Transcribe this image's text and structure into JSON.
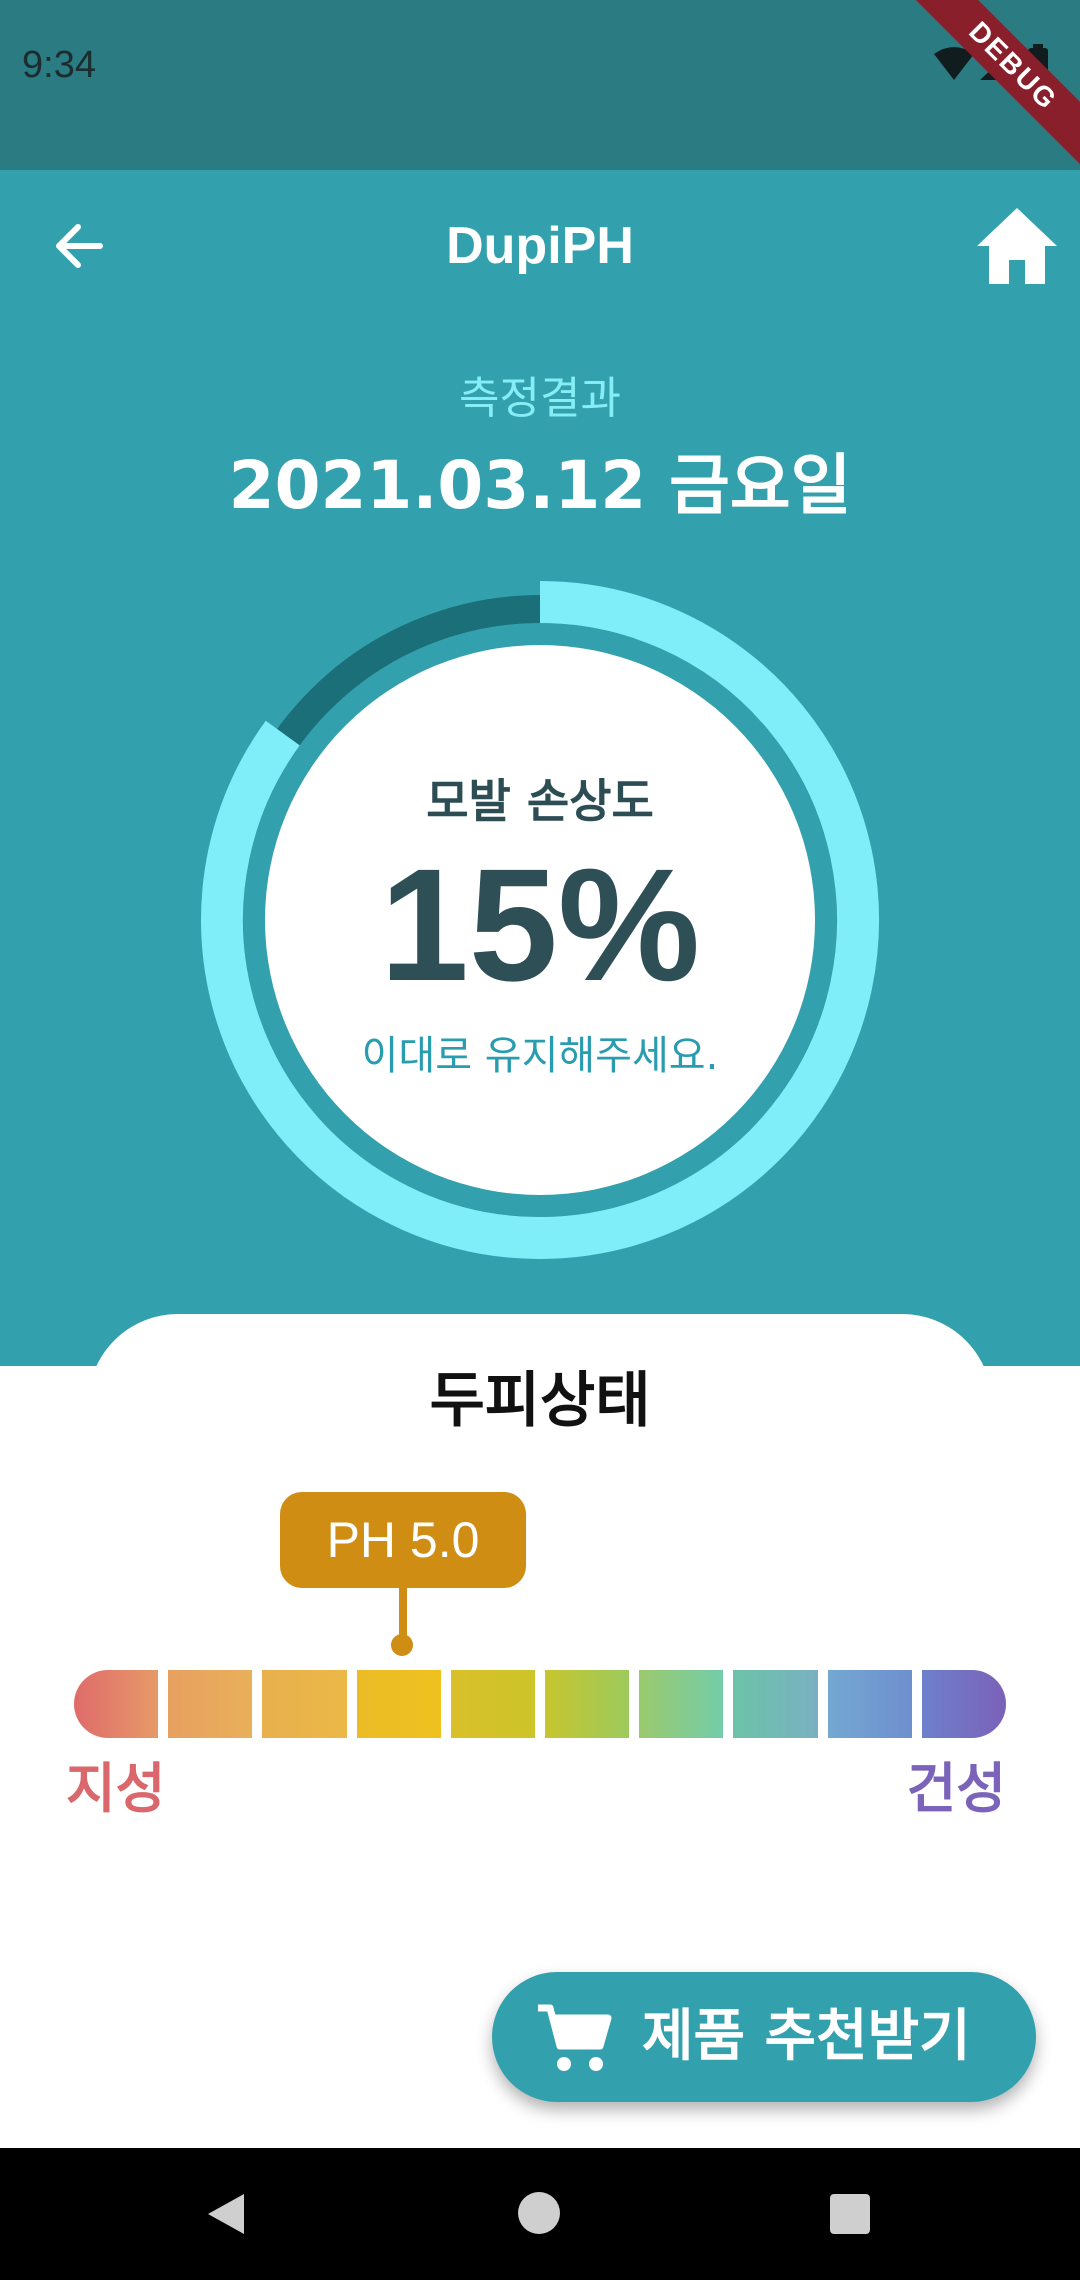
{
  "status_bar": {
    "time": "9:34",
    "icons": [
      "wifi-icon",
      "signal-icon",
      "battery-icon"
    ]
  },
  "debug_banner": "DEBUG",
  "header": {
    "back_icon": "arrow-left-icon",
    "title": "DupiPH",
    "home_icon": "home-icon"
  },
  "result": {
    "label": "측정결과",
    "date": "2021.03.12  금요일"
  },
  "damage_gauge": {
    "title": "모발 손상도",
    "value_text": "15%",
    "level_percent": 15,
    "message": "이대로 유지해주세요.",
    "colors": {
      "track": "#1b6f78",
      "fill": "#80eef9",
      "inner": "#ffffff"
    }
  },
  "scalp": {
    "title": "두피상태",
    "ph_badge": "PH 5.0",
    "ph_value": 5.0,
    "scale_label_left": "지성",
    "scale_label_right": "건성",
    "scale_colors": [
      [
        "#df6b6b",
        "#e79a68"
      ],
      [
        "#e7a060",
        "#e8b05a"
      ],
      [
        "#e8b04e",
        "#ebb846"
      ],
      [
        "#ecbc27",
        "#eec11f"
      ],
      [
        "#dac02b",
        "#ccc42a"
      ],
      [
        "#c6c52f",
        "#9dca5d"
      ],
      [
        "#9bca6d",
        "#73ccaa"
      ],
      [
        "#6cc3a8",
        "#7ab0c2"
      ],
      [
        "#74a8d2",
        "#6e8fce"
      ],
      [
        "#6e80cc",
        "#7b61b8"
      ]
    ]
  },
  "recommend_button": {
    "icon": "cart-icon",
    "label": "제품 추천받기"
  },
  "nav_bar": {
    "icons": [
      "nav-back-icon",
      "nav-home-icon",
      "nav-recents-icon"
    ]
  }
}
